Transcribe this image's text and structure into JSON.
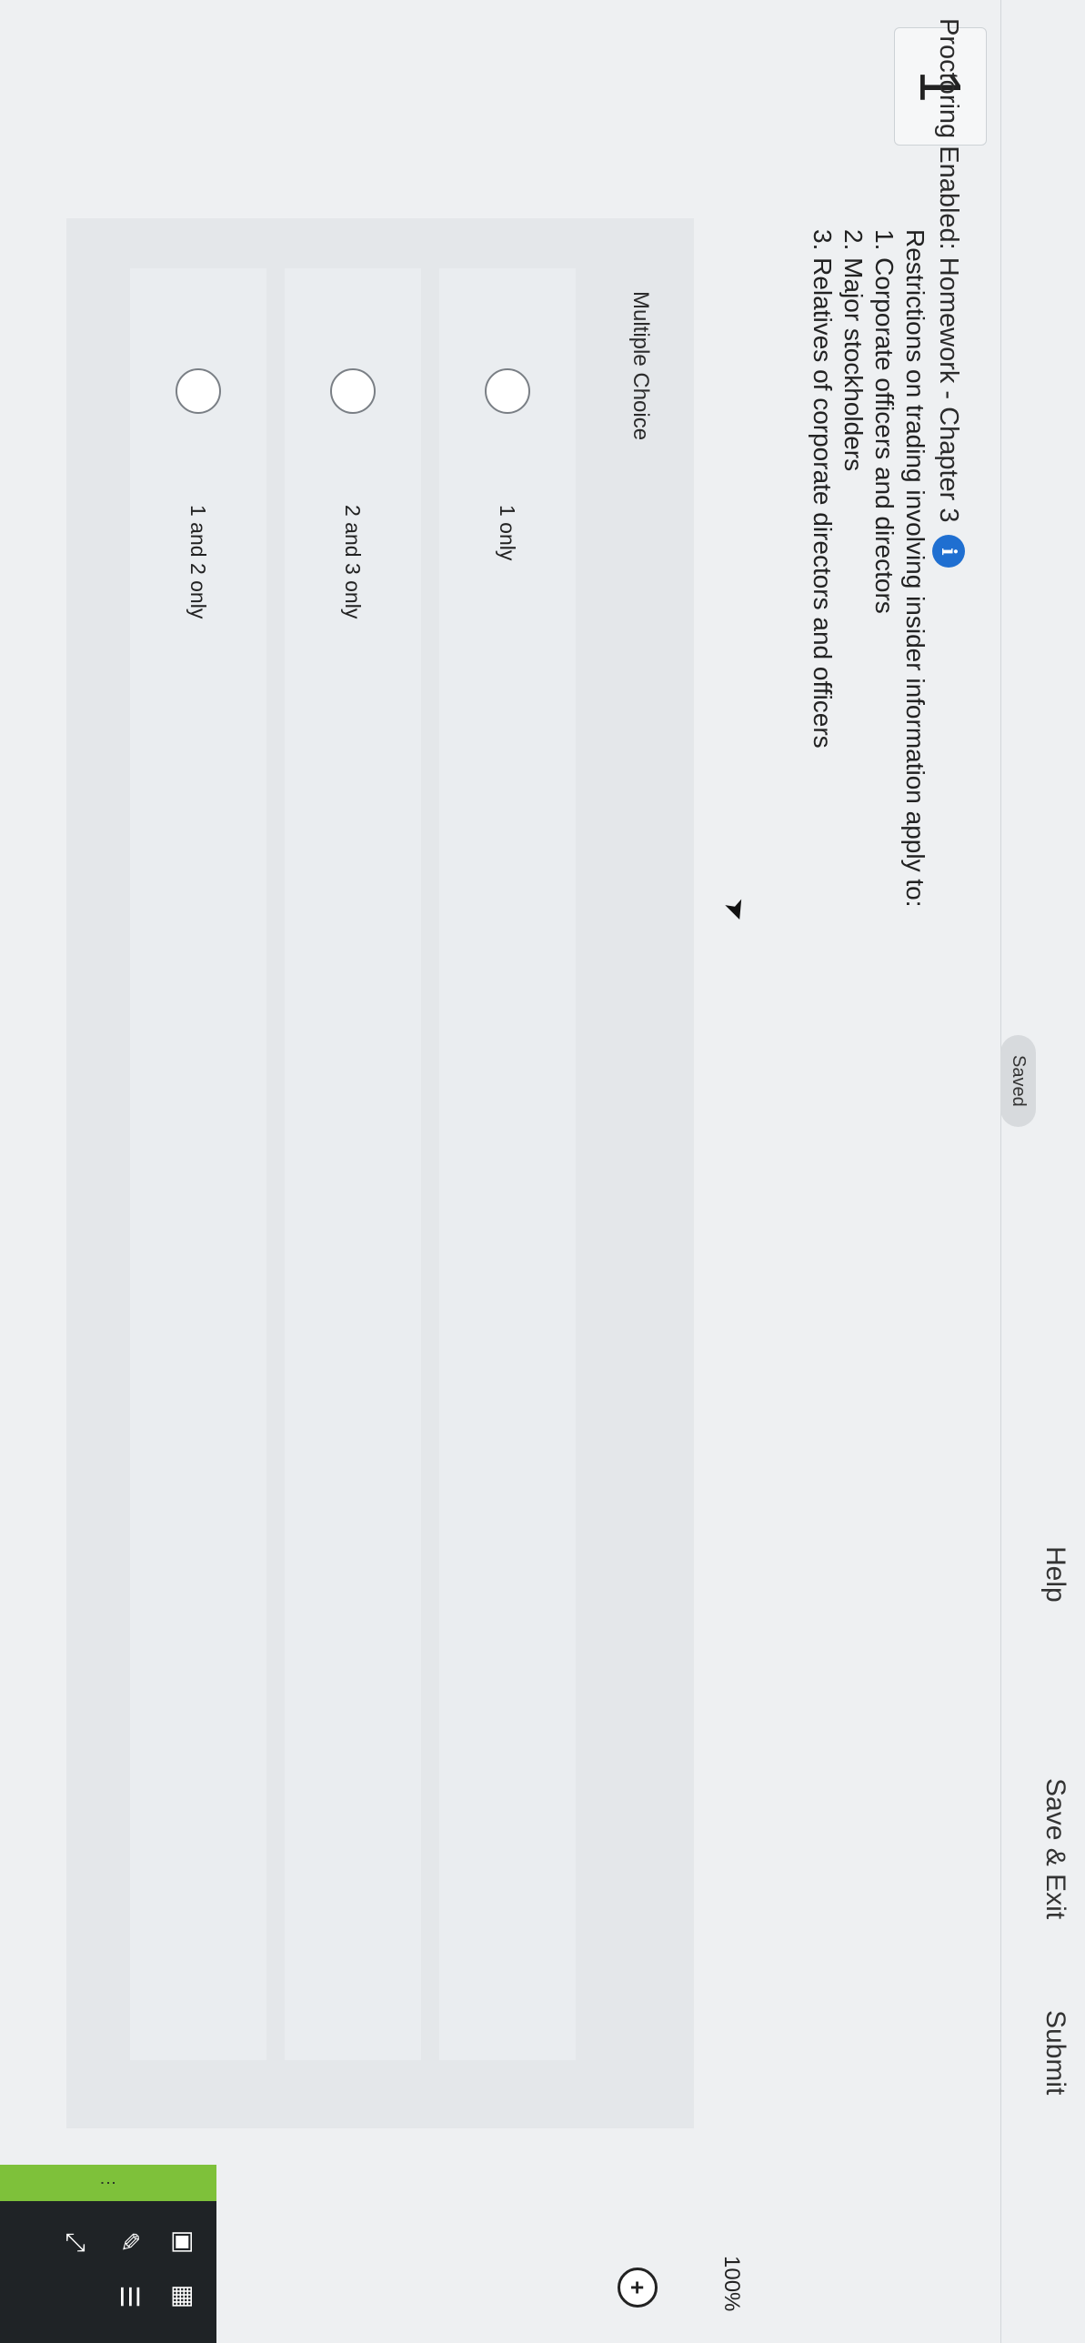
{
  "header": {
    "title": "Proctoring Enabled: Homework - Chapter 3",
    "saved": "Saved",
    "help": "Help",
    "save_exit": "Save & Exit",
    "submit": "Submit"
  },
  "question": {
    "number": "1",
    "text": "Restrictions on trading involving insider information apply to:\n1. Corporate officers and directors\n2. Major stockholders\n3. Relatives of corporate directors and officers",
    "type_label": "Multiple Choice",
    "choices": [
      "1 only",
      "2 and 3 only",
      "1 and 2 only"
    ]
  },
  "zoom": {
    "level": "100%"
  },
  "icons": {
    "info": "info-icon",
    "zoom_in": "zoom-in-icon",
    "zoom_out": "zoom-out-icon"
  },
  "colors": {
    "accent": "#1f6fd1",
    "toolbar_green": "#7ec13a"
  }
}
